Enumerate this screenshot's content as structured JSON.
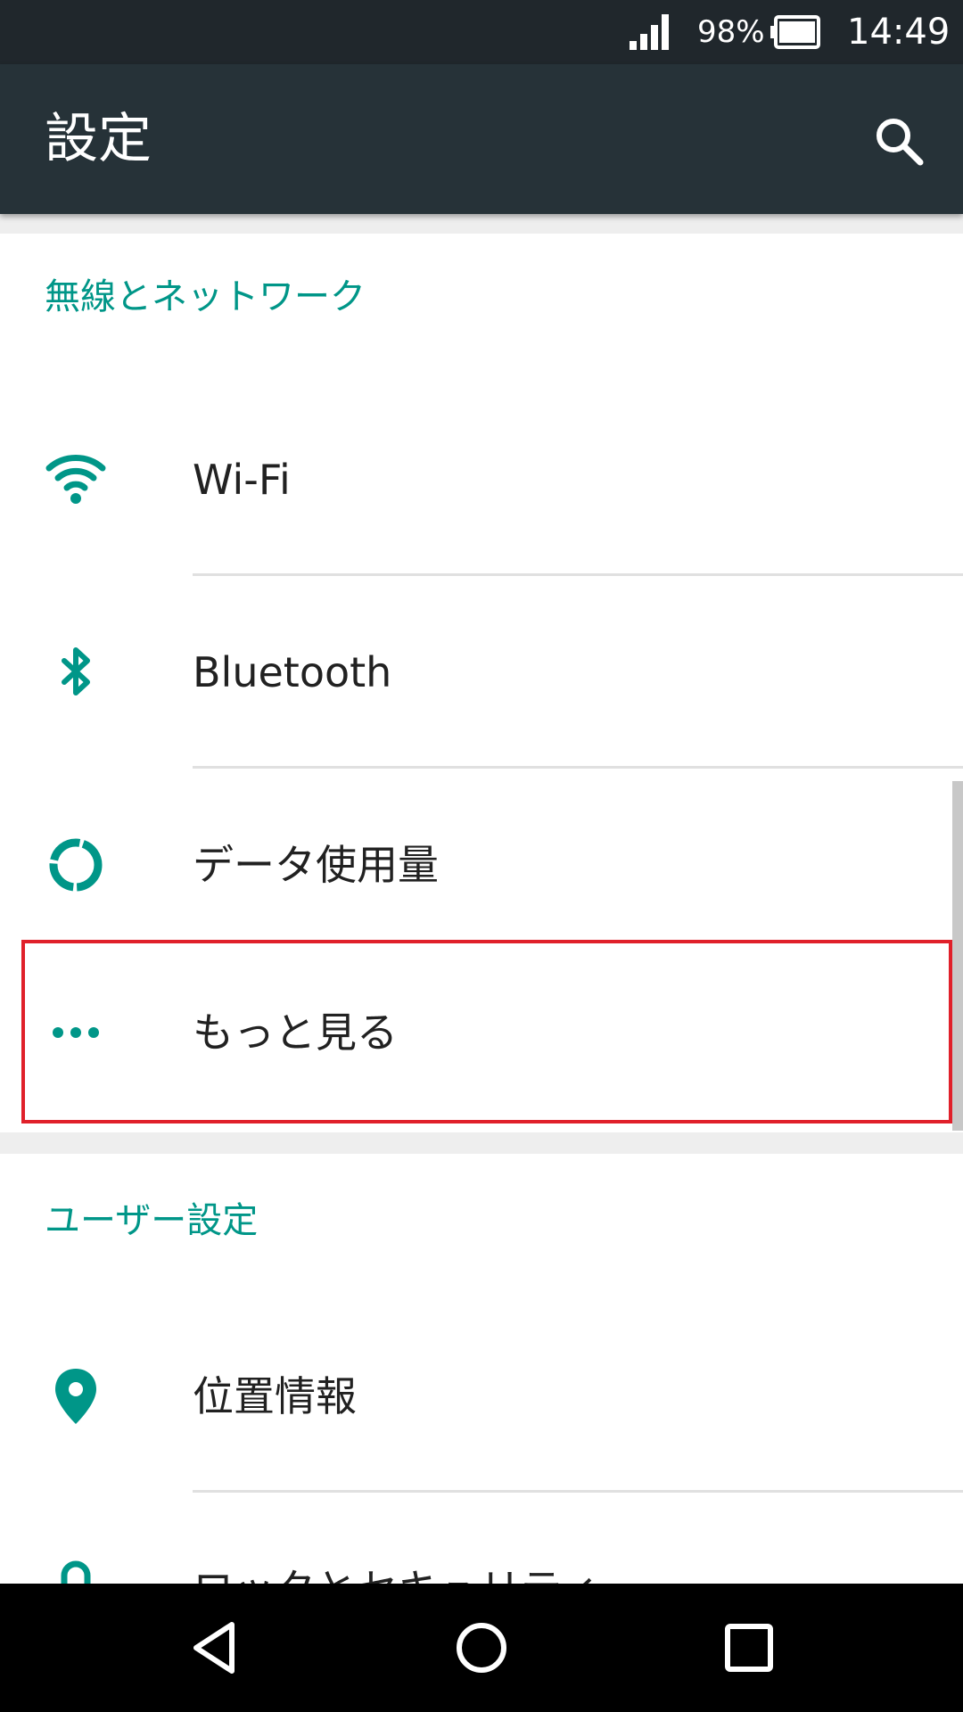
{
  "status_bar": {
    "battery_percent": "98%",
    "time": "14:49",
    "icons": [
      "signal-icon",
      "battery-icon"
    ]
  },
  "app_bar": {
    "title": "設定",
    "search_icon": "search-icon"
  },
  "sections": [
    {
      "header": "無線とネットワーク",
      "items": [
        {
          "label": "Wi-Fi",
          "icon": "wifi-icon"
        },
        {
          "label": "Bluetooth",
          "icon": "bluetooth-icon"
        },
        {
          "label": "データ使用量",
          "icon": "data-usage-icon"
        },
        {
          "label": "もっと見る",
          "icon": "more-icon",
          "highlighted": true
        }
      ]
    },
    {
      "header": "ユーザー設定",
      "items": [
        {
          "label": "位置情報",
          "icon": "location-icon"
        },
        {
          "label": "ロックとセキュリティ",
          "icon": "lock-icon"
        }
      ]
    }
  ],
  "navigation_bar": {
    "icons": [
      "back-icon",
      "home-icon",
      "recents-icon"
    ]
  },
  "colors": {
    "accent": "#009688",
    "app_bar": "#263238",
    "status_bar": "#20272c",
    "highlight_border": "#e0202a"
  }
}
